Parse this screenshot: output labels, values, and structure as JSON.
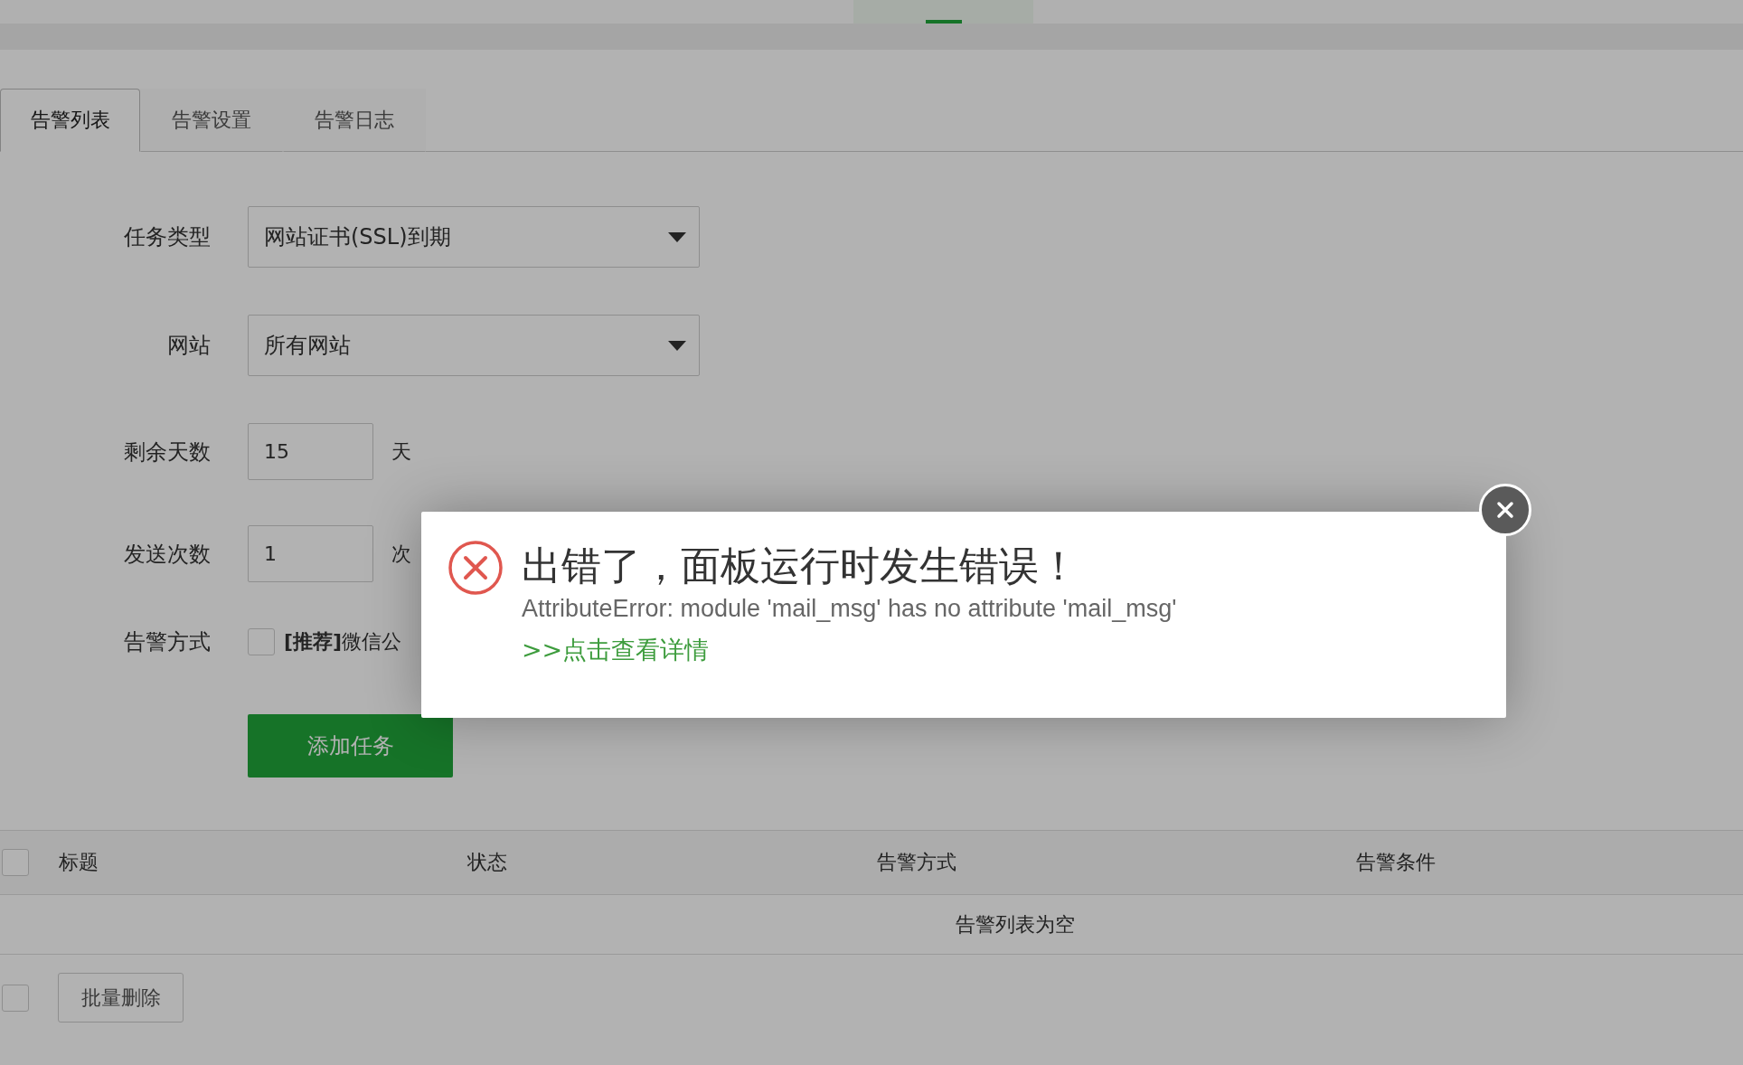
{
  "top_bar": {
    "active_segment": true
  },
  "tabs": [
    {
      "label": "告警列表",
      "selected": true
    },
    {
      "label": "告警设置",
      "selected": false
    },
    {
      "label": "告警日志",
      "selected": false
    }
  ],
  "form": [
    {
      "kind": "select",
      "label": "任务类型",
      "value": "网站证书(SSL)到期"
    },
    {
      "kind": "select",
      "label": "网站",
      "value": "所有网站"
    },
    {
      "kind": "input",
      "label": "剩余天数",
      "value": "15",
      "suffix": "天"
    },
    {
      "kind": "input",
      "label": "发送次数",
      "value": "1",
      "suffix": "次"
    },
    {
      "kind": "checkbox",
      "label": "告警方式",
      "checked": false,
      "text": "**[推荐]**微信公"
    }
  ],
  "add_button": "添加任务",
  "table": {
    "select_all": {
      "checked": false
    },
    "columns": [
      "标题",
      "状态",
      "告警方式",
      "告警条件"
    ],
    "empty_text": "告警列表为空"
  },
  "footer": {
    "select_all": {
      "checked": false
    },
    "batch_delete": "批量删除"
  },
  "modal": {
    "title": "出错了，面板运行时发生错误！",
    "message": "AttributeError: module 'mail_msg' has no attribute 'mail_msg'",
    "link": ">>点击查看详情"
  }
}
